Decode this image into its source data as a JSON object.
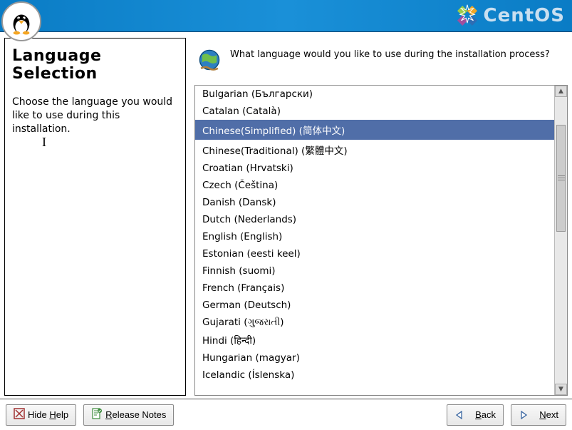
{
  "header": {
    "brand": "CentOS"
  },
  "left": {
    "title": "Language Selection",
    "description": "Choose the language you would like to use during this installation."
  },
  "right": {
    "question": "What language would you like to use during the installation process?"
  },
  "languages": [
    "Bulgarian (Български)",
    "Catalan (Català)",
    "Chinese(Simplified) (简体中文)",
    "Chinese(Traditional) (繁體中文)",
    "Croatian (Hrvatski)",
    "Czech (Čeština)",
    "Danish (Dansk)",
    "Dutch (Nederlands)",
    "English (English)",
    "Estonian (eesti keel)",
    "Finnish (suomi)",
    "French (Français)",
    "German (Deutsch)",
    "Gujarati (ગુજરાતી)",
    "Hindi (हिन्दी)",
    "Hungarian (magyar)",
    "Icelandic (Íslenska)"
  ],
  "selected_index": 2,
  "footer": {
    "hide_help": "Hide Help",
    "release_notes": "Release Notes",
    "back": "Back",
    "next": "Next"
  },
  "colors": {
    "sel_bg": "#506ea8",
    "header_bg": "#0a7cc5"
  }
}
